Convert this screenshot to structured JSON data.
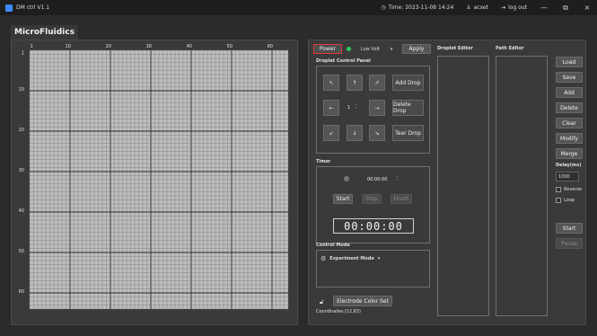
{
  "titlebar": {
    "title": "DM ctrl V1.1",
    "time": "Time: 2023-11-08 14:24",
    "user": "acxet",
    "logout": "log out",
    "minimize": "—",
    "maximize": "⧉",
    "close": "×"
  },
  "tab": {
    "label": "MicroFluidics"
  },
  "grid": {
    "cols": 64,
    "rows": 64,
    "col_labels": [
      "1",
      "10",
      "20",
      "30",
      "40",
      "50",
      "60"
    ],
    "row_labels": [
      "1",
      "10",
      "20",
      "30",
      "40",
      "50",
      "60"
    ],
    "colors": {
      "background": "#bdbdbd",
      "line": "#6e6e6e",
      "major_line": "#2a2a2a"
    }
  },
  "power": {
    "label": "Power",
    "status_color": "#2ec95c"
  },
  "volt_select": {
    "value": "Low Volt",
    "arrow": "▾"
  },
  "apply": {
    "label": "Apply"
  },
  "droplet_panel": {
    "title": "Droplet Control Panel",
    "arrows": {
      "up_left": "↖",
      "up": "↑",
      "up_right": "↗",
      "left": "←",
      "right": "→",
      "down_left": "↙",
      "down": "↓",
      "down_right": "↘"
    },
    "step_value": "1",
    "add_drop": "Add Drop",
    "delete_drop": "Delete Drop",
    "tear_drop": "Tear Drop"
  },
  "timer": {
    "title": "Timer",
    "time_value": "00:00:00",
    "start": "Start",
    "stop": "Stop",
    "finish": "Finish",
    "display": "00:00:00"
  },
  "control_mode": {
    "title": "Control Mode",
    "value": "Experiment Mode",
    "arrow": "▾"
  },
  "electrode": {
    "label": "Electrode Color Set",
    "coordinates": "Coordinates:(12,63)"
  },
  "editors": {
    "droplet": "Droplet Editor",
    "path": "Path Editor"
  },
  "side_buttons": {
    "load": "Load",
    "save": "Save",
    "add": "Add",
    "delete": "Delete",
    "clear": "Clear",
    "modify": "Modify",
    "merge": "Merge",
    "delay_label": "Delay(ms)",
    "delay_value": "1000",
    "reverse": "Reverse",
    "loop": "Loop",
    "start": "Start",
    "pause": "Pause"
  }
}
